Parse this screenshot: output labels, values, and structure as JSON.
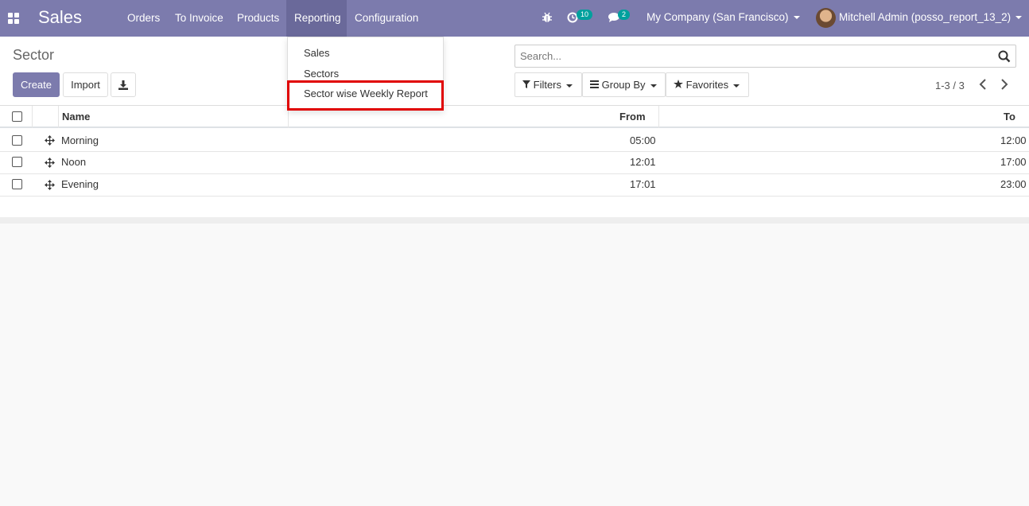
{
  "navbar": {
    "app_title": "Sales",
    "menu": [
      "Orders",
      "To Invoice",
      "Products",
      "Reporting",
      "Configuration"
    ],
    "activity_badge": "10",
    "messages_badge": "2",
    "company": "My Company (San Francisco)",
    "user": "Mitchell Admin (posso_report_13_2)",
    "accent_color": "#7c7bad"
  },
  "reporting_menu": {
    "items": [
      "Sales",
      "Sectors",
      "Sector wise Weekly Report"
    ],
    "highlighted": "Sector wise Weekly Report",
    "highlight_color": "#e00000"
  },
  "control_panel": {
    "breadcrumb": "Sector",
    "create_label": "Create",
    "import_label": "Import",
    "search_placeholder": "Search...",
    "filters_label": "Filters",
    "group_by_label": "Group By",
    "favorites_label": "Favorites",
    "pager": "1-3 / 3"
  },
  "table": {
    "columns": [
      "Name",
      "From",
      "To"
    ],
    "rows": [
      {
        "name": "Morning",
        "from": "05:00",
        "to": "12:00"
      },
      {
        "name": "Noon",
        "from": "12:01",
        "to": "17:00"
      },
      {
        "name": "Evening",
        "from": "17:01",
        "to": "23:00"
      }
    ]
  }
}
